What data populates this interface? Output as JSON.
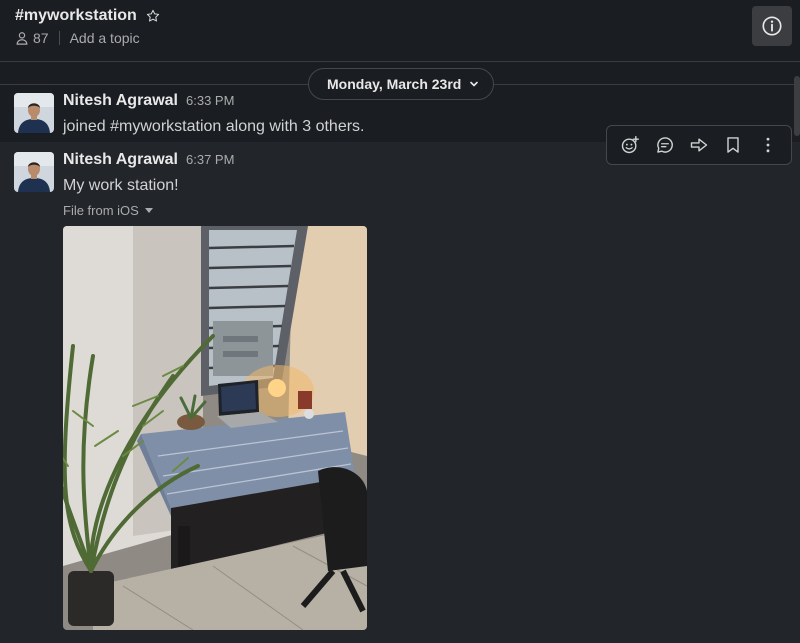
{
  "header": {
    "channel_name": "#myworkstation",
    "member_count": "87",
    "add_topic": "Add a topic"
  },
  "date_divider": {
    "label": "Monday, March 23rd"
  },
  "messages": [
    {
      "author": "Nitesh Agrawal",
      "time": "6:33 PM",
      "text": "joined #myworkstation along with 3 others."
    },
    {
      "author": "Nitesh Agrawal",
      "time": "6:37 PM",
      "text": "My work station!",
      "file_label": "File from iOS"
    }
  ],
  "message_actions": [
    "add-reaction-icon",
    "reply-in-thread-icon",
    "share-message-icon",
    "save-message-icon",
    "more-actions-icon"
  ],
  "colors": {
    "background": "#1a1d21",
    "hover_background": "#222529",
    "text_primary": "#e8e8e8",
    "text_secondary": "#ababad"
  }
}
